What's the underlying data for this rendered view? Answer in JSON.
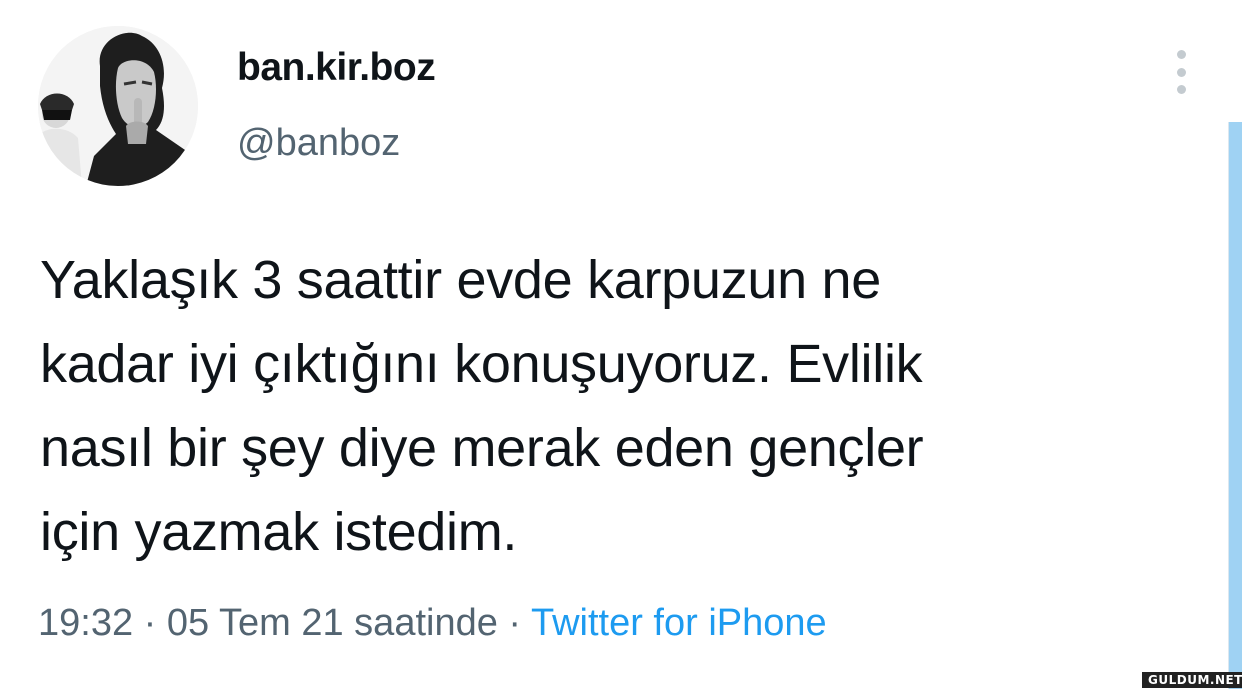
{
  "user": {
    "display_name": "ban.kir.boz",
    "handle": "@banboz",
    "avatar_icon": "profile-photo-avatar"
  },
  "tweet": {
    "lines": [
      "Yaklaşık 3 saattir evde karpuzun ne",
      "kadar iyi çıktığını konuşuyoruz. Evlilik",
      "nasıl bir şey diye merak eden gençler",
      "için yazmak istedim."
    ]
  },
  "meta": {
    "time": "19:32",
    "separator": "·",
    "date": "05 Tem 21 saatinde",
    "source": "Twitter for iPhone"
  },
  "menu": {
    "icon": "vertical-ellipsis-icon"
  },
  "watermark": "GULDUM.NET",
  "colors": {
    "text_primary": "#0f1419",
    "text_secondary": "#536471",
    "link": "#1d9bf0",
    "scrollbar": "#9fd2f3"
  }
}
